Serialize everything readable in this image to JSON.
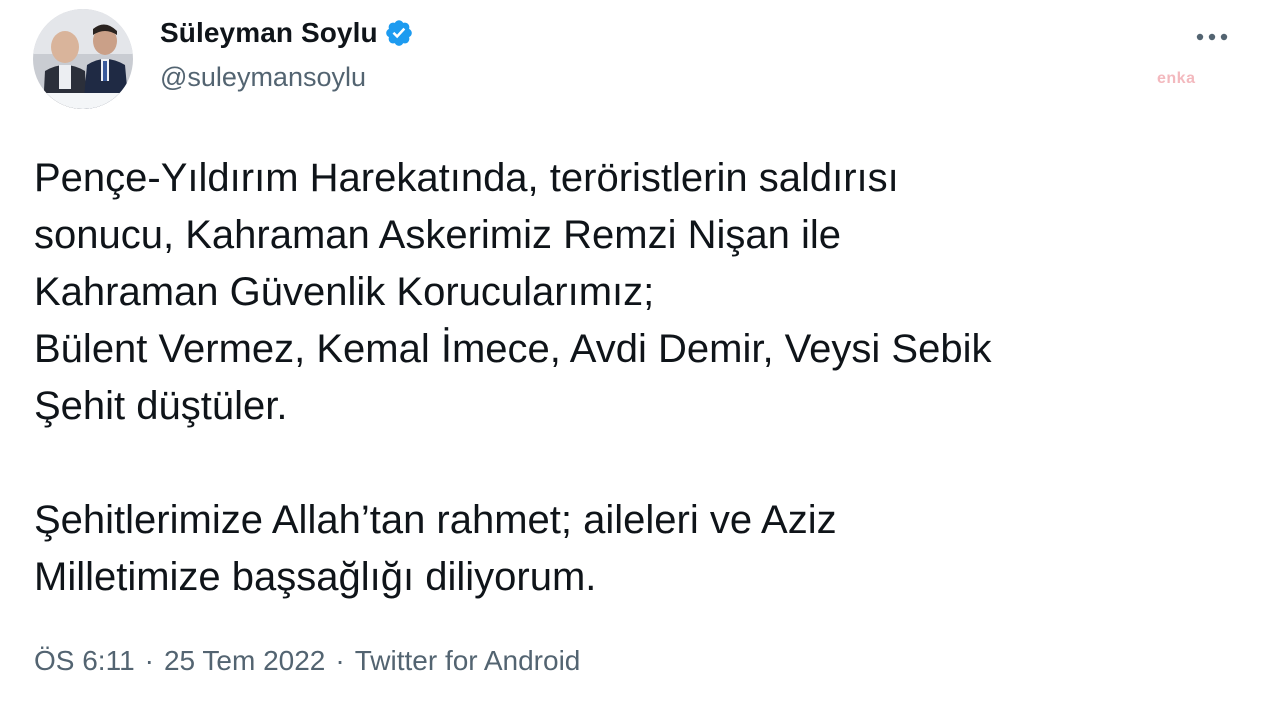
{
  "user": {
    "display_name": "Süleyman Soylu",
    "handle": "@suleymansoylu",
    "avatar_icon": "profile-photo",
    "verified_icon": "verified-badge-icon"
  },
  "watermark": "enka",
  "tweet": {
    "lines": [
      "Pençe-Yıldırım Harekatında, teröristlerin saldırısı",
      "sonucu, Kahraman Askerimiz Remzi Nişan ile",
      "Kahraman Güvenlik Korucularımız;",
      "Bülent Vermez, Kemal İmece, Avdi Demir, Veysi Sebik",
      "Şehit düştüler."
    ],
    "lines2": [
      "Şehitlerimize Allah’tan rahmet; aileleri ve Aziz",
      "Milletimize başsağlığı diliyorum."
    ]
  },
  "meta": {
    "time": "ÖS 6:11",
    "sep1": "·",
    "date": "25 Tem 2022",
    "sep2": "·",
    "source": "Twitter for Android"
  },
  "colors": {
    "text": "#0f1419",
    "secondary": "#536471",
    "verified": "#1d9bf0"
  }
}
